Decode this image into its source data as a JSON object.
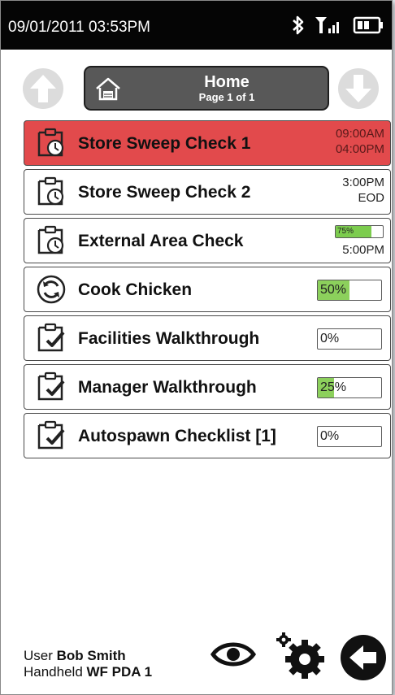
{
  "status": {
    "datetime": "09/01/2011  03:53PM"
  },
  "header": {
    "title": "Home",
    "subtitle": "Page 1 of 1"
  },
  "colors": {
    "alert": "#e24a4c",
    "progress": "#8cd05c",
    "nav_arrow": "#dcdcdc",
    "home_bg": "#585858"
  },
  "tasks": [
    {
      "label": "Store Sweep Check 1",
      "icon": "clipboard-clock-icon",
      "time_top": "09:00AM",
      "time_bottom": "04:00PM",
      "state": "overdue"
    },
    {
      "label": "Store Sweep Check 2",
      "icon": "clipboard-clock-icon",
      "time_top": "3:00PM",
      "time_bottom": "EOD"
    },
    {
      "label": "External Area Check",
      "icon": "clipboard-clock-icon",
      "progress_text": "75%",
      "progress": 0.75,
      "time_bottom": "5:00PM"
    },
    {
      "label": "Cook Chicken",
      "icon": "recurring-arrows-icon",
      "progress_text": "50%",
      "progress": 0.5
    },
    {
      "label": "Facilities Walkthrough",
      "icon": "clipboard-check-icon",
      "progress_text": "0%",
      "progress": 0
    },
    {
      "label": "Manager Walkthrough",
      "icon": "clipboard-check-icon",
      "progress_text": "25%",
      "progress": 0.25
    },
    {
      "label": "Autospawn Checklist [1]",
      "icon": "clipboard-check-icon",
      "progress_text": "0%",
      "progress": 0
    }
  ],
  "footer": {
    "user_label": "User",
    "user_name": "Bob Smith",
    "device_label": "Handheld",
    "device_name": "WF PDA 1"
  }
}
